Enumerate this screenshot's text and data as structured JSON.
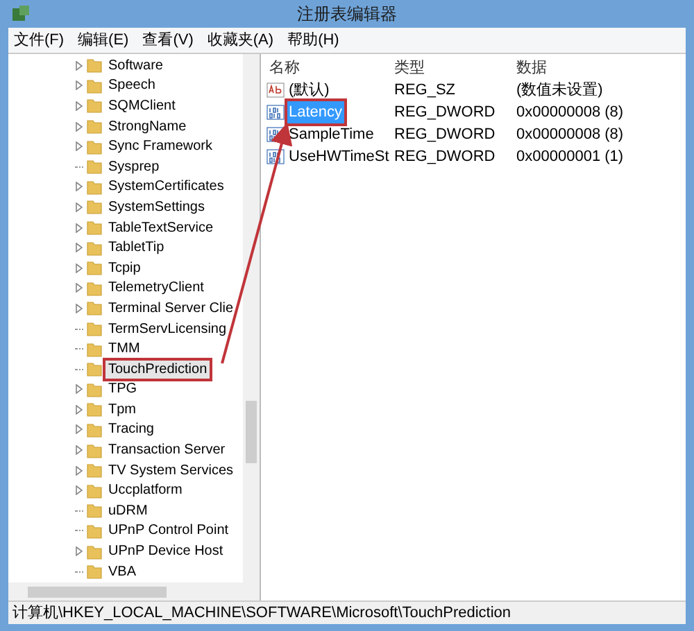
{
  "window": {
    "title": "注册表编辑器"
  },
  "menu": [
    "文件(F)",
    "编辑(E)",
    "查看(V)",
    "收藏夹(A)",
    "帮助(H)"
  ],
  "tree": {
    "items": [
      {
        "label": "Software",
        "expandable": true,
        "selected": false
      },
      {
        "label": "Speech",
        "expandable": true,
        "selected": false
      },
      {
        "label": "SQMClient",
        "expandable": true,
        "selected": false
      },
      {
        "label": "StrongName",
        "expandable": true,
        "selected": false
      },
      {
        "label": "Sync Framework",
        "expandable": true,
        "selected": false
      },
      {
        "label": "Sysprep",
        "expandable": false,
        "selected": false
      },
      {
        "label": "SystemCertificates",
        "expandable": true,
        "selected": false
      },
      {
        "label": "SystemSettings",
        "expandable": true,
        "selected": false
      },
      {
        "label": "TableTextService",
        "expandable": true,
        "selected": false
      },
      {
        "label": "TabletTip",
        "expandable": true,
        "selected": false
      },
      {
        "label": "Tcpip",
        "expandable": true,
        "selected": false
      },
      {
        "label": "TelemetryClient",
        "expandable": true,
        "selected": false
      },
      {
        "label": "Terminal Server Clie",
        "expandable": true,
        "selected": false
      },
      {
        "label": "TermServLicensing",
        "expandable": false,
        "selected": false
      },
      {
        "label": "TMM",
        "expandable": false,
        "selected": false
      },
      {
        "label": "TouchPrediction",
        "expandable": false,
        "selected": true
      },
      {
        "label": "TPG",
        "expandable": true,
        "selected": false
      },
      {
        "label": "Tpm",
        "expandable": true,
        "selected": false
      },
      {
        "label": "Tracing",
        "expandable": true,
        "selected": false
      },
      {
        "label": "Transaction Server",
        "expandable": true,
        "selected": false
      },
      {
        "label": "TV System Services",
        "expandable": true,
        "selected": false
      },
      {
        "label": "Uccplatform",
        "expandable": true,
        "selected": false
      },
      {
        "label": "uDRM",
        "expandable": false,
        "selected": false
      },
      {
        "label": "UPnP Control Point",
        "expandable": false,
        "selected": false
      },
      {
        "label": "UPnP Device Host",
        "expandable": true,
        "selected": false
      },
      {
        "label": "VBA",
        "expandable": false,
        "selected": false
      }
    ]
  },
  "values": {
    "columns": [
      "名称",
      "类型",
      "数据"
    ],
    "rows": [
      {
        "kind": "string",
        "name": "(默认)",
        "type": "REG_SZ",
        "data": "(数值未设置)",
        "selected": false
      },
      {
        "kind": "dword",
        "name": "Latency",
        "type": "REG_DWORD",
        "data": "0x00000008 (8)",
        "selected": true
      },
      {
        "kind": "dword",
        "name": "SampleTime",
        "type": "REG_DWORD",
        "data": "0x00000008 (8)",
        "selected": false
      },
      {
        "kind": "dword",
        "name": "UseHWTimeSt",
        "type": "REG_DWORD",
        "data": "0x00000001 (1)",
        "selected": false
      }
    ]
  },
  "status_bar": "计算机\\HKEY_LOCAL_MACHINE\\SOFTWARE\\Microsoft\\TouchPrediction"
}
